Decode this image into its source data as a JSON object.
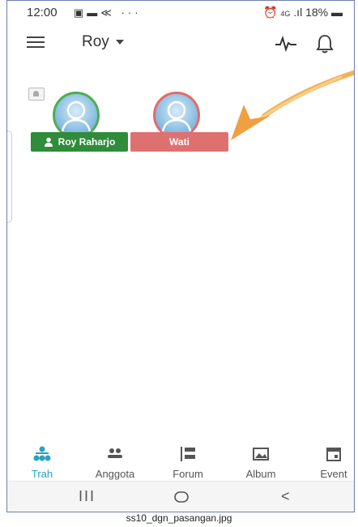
{
  "status_bar": {
    "time": "12:00",
    "dots": "···",
    "network": "4G",
    "battery": "18%"
  },
  "app_bar": {
    "current_user": "Roy"
  },
  "tree": {
    "members": [
      {
        "name": "Roy Raharjo",
        "gender": "male",
        "color": "#2e8c3a"
      },
      {
        "name": "Wati",
        "gender": "female",
        "color": "#df7070"
      }
    ]
  },
  "bottom_nav": {
    "items": [
      {
        "label": "Trah",
        "icon": "family-tree-icon",
        "active": true
      },
      {
        "label": "Anggota",
        "icon": "people-icon",
        "active": false
      },
      {
        "label": "Forum",
        "icon": "forum-icon",
        "active": false
      },
      {
        "label": "Album",
        "icon": "album-icon",
        "active": false
      },
      {
        "label": "Event",
        "icon": "calendar-icon",
        "active": false
      }
    ]
  },
  "system_nav": {
    "recents": "III",
    "back": "<"
  },
  "caption": "ss10_dgn_pasangan.jpg",
  "colors": {
    "accent": "#28a3c4",
    "male": "#2e8c3a",
    "female": "#df7070",
    "arrow": "#f0a040"
  }
}
